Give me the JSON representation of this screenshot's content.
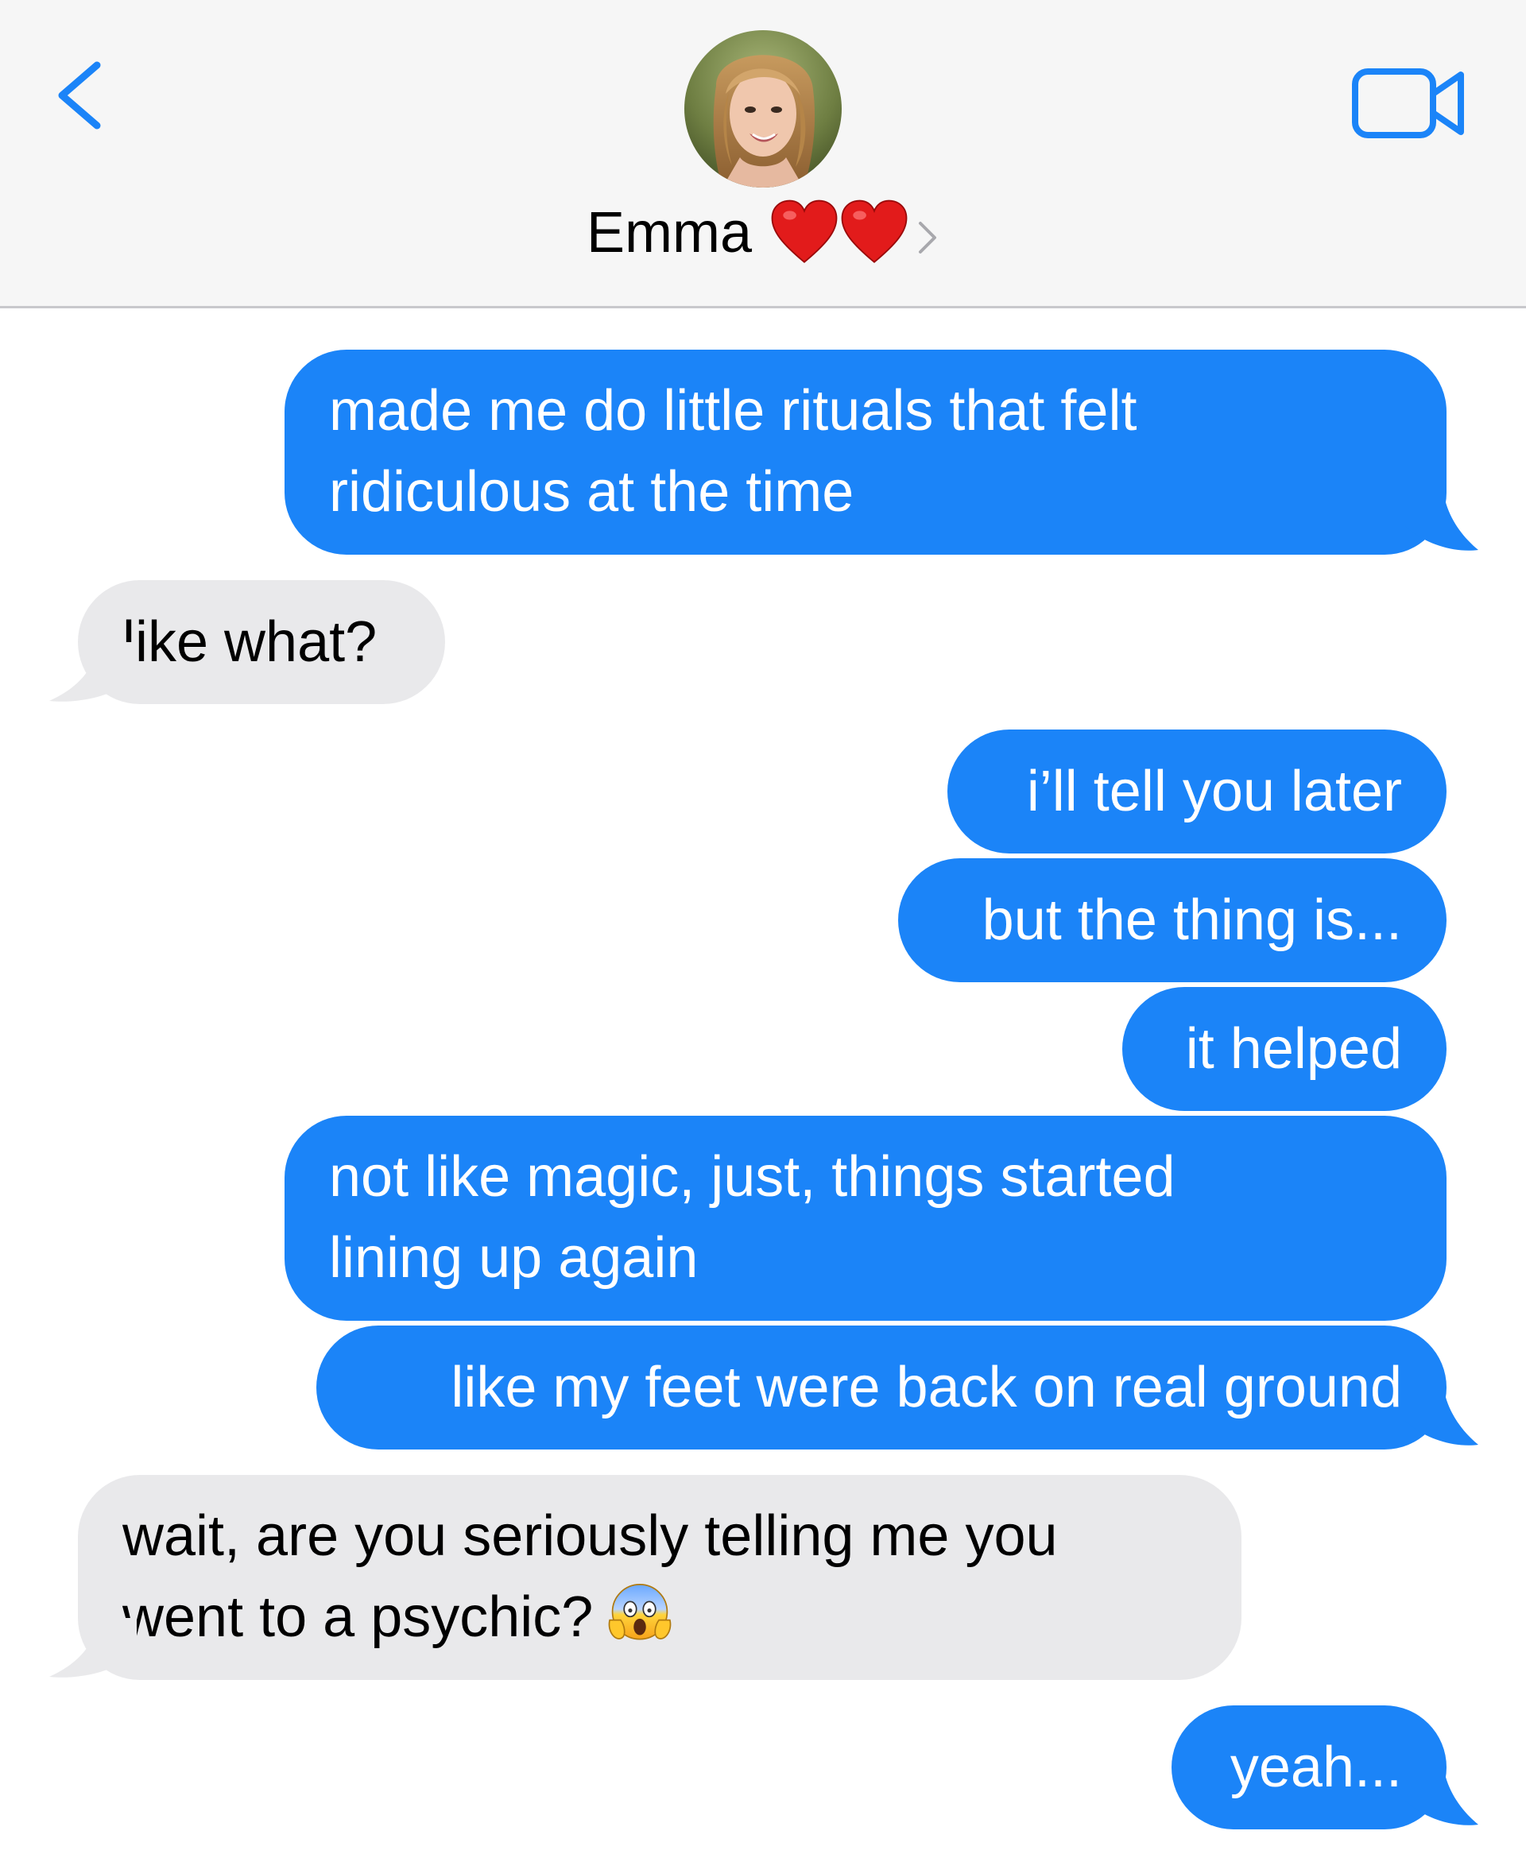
{
  "header": {
    "contact_name": "Emma",
    "name_emoji": "red-heart-emoji ×2",
    "back_icon": "chevron-left-icon",
    "video_icon": "facetime-video-icon",
    "accent_color": "#1b84f8"
  },
  "messages": [
    {
      "direction": "sent",
      "lines": [
        "made me do little rituals that felt",
        "ridiculous at the time"
      ]
    },
    {
      "direction": "received",
      "lines": [
        "like what?"
      ]
    },
    {
      "direction": "sent",
      "lines": [
        "i’ll tell you later"
      ]
    },
    {
      "direction": "sent",
      "lines": [
        "but the thing is..."
      ]
    },
    {
      "direction": "sent",
      "lines": [
        "it helped"
      ]
    },
    {
      "direction": "sent",
      "lines": [
        "not like magic, just, things started",
        "lining up again"
      ]
    },
    {
      "direction": "sent",
      "lines": [
        "like my feet were back on real ground"
      ]
    },
    {
      "direction": "received",
      "lines": [
        "wait, are you seriously telling me you",
        "went to a psychic?"
      ],
      "trailing_emoji": "face-screaming-in-fear-emoji"
    },
    {
      "direction": "sent",
      "lines": [
        "yeah..."
      ]
    }
  ],
  "colors": {
    "sent_bubble": "#1b84f8",
    "received_bubble": "#e9e9eb",
    "header_bg": "#f6f6f6"
  }
}
